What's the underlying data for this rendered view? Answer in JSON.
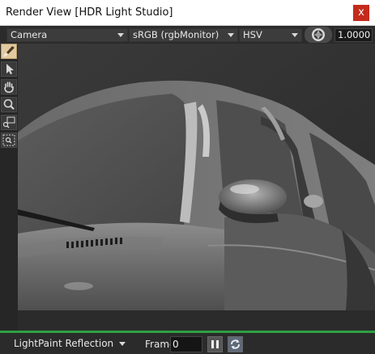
{
  "window": {
    "title": "Render View [HDR Light Studio]",
    "close_glyph": "x"
  },
  "toolbar": {
    "view_select": "Camera",
    "colorspace_select": "sRGB (rgbMonitor)",
    "mode_select": "HSV",
    "exposure_icon": "aperture-icon",
    "exposure_value": "1.0000"
  },
  "tools": [
    {
      "name": "paint-brush-icon",
      "active": true
    },
    {
      "name": "select-arrow-icon",
      "active": false
    },
    {
      "name": "pan-hand-icon",
      "active": false
    },
    {
      "name": "zoom-icon",
      "active": false
    },
    {
      "name": "zoom-region-icon",
      "active": false
    },
    {
      "name": "zoom-fit-icon",
      "active": false
    }
  ],
  "viewport": {
    "content": "render of grey car",
    "light_button_icon": "light-dome-icon"
  },
  "statusbar": {
    "mode_select": "LightPaint Reflection",
    "frame_label": "Frame",
    "frame_value": "0",
    "pause_icon": "pause-icon",
    "loop_icon": "loop-icon",
    "accent_color": "#2ea043"
  }
}
